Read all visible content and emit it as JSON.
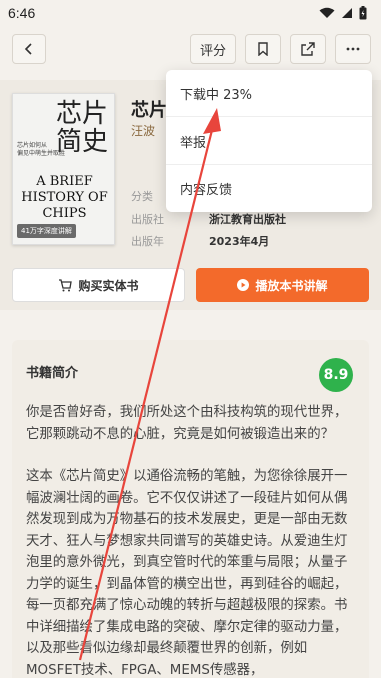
{
  "status_bar": {
    "time": "6:46"
  },
  "toolbar": {
    "rate_label": "评分"
  },
  "book": {
    "cover": {
      "cn_title_line1": "芯片",
      "cn_title_line2": "简史",
      "cn_subtitle_1": "芯片如何从",
      "cn_subtitle_2": "偏见中萌生并取胜",
      "en_title_1": "A BRIEF",
      "en_title_2": "HISTORY OF",
      "en_title_3": "CHIPS",
      "badge": "41万字深度讲解"
    },
    "title": "芯片",
    "author": "汪波",
    "meta": [
      {
        "key": "分类",
        "value": ""
      },
      {
        "key": "出版社",
        "value": "浙江教育出版社"
      },
      {
        "key": "出版年",
        "value": "2023年4月"
      }
    ]
  },
  "actions": {
    "buy_label": "购买实体书",
    "play_label": "播放本书讲解"
  },
  "summary": {
    "title": "书籍简介",
    "score": "8.9",
    "paragraph1": "你是否曾好奇，我们所处这个由科技构筑的现代世界，它那颗跳动不息的心脏，究竟是如何被锻造出来的？",
    "paragraph2": "这本《芯片简史》以通俗流畅的笔触，为您徐徐展开一幅波澜壮阔的画卷。它不仅仅讲述了一段硅片如何从偶然发现到成为万物基石的技术发展史，更是一部由无数天才、狂人与梦想家共同谱写的英雄史诗。从爱迪生灯泡里的意外微光，到真空管时代的笨重与局限；从量子力学的诞生，到晶体管的横空出世，再到硅谷的崛起，每一页都充满了惊心动魄的转折与超越极限的探索。书中详细描绘了集成电路的突破、摩尔定律的驱动力量，以及那些看似边缘却最终颠覆世界的创新，例如MOSFET技术、FPGA、MEMS传感器，"
  },
  "menu": {
    "items": [
      "下载中 23%",
      "举报",
      "内容反馈"
    ]
  },
  "colors": {
    "accent": "#f36a2b",
    "score_bg": "#2fb24c",
    "annotation": "#e8453c"
  }
}
